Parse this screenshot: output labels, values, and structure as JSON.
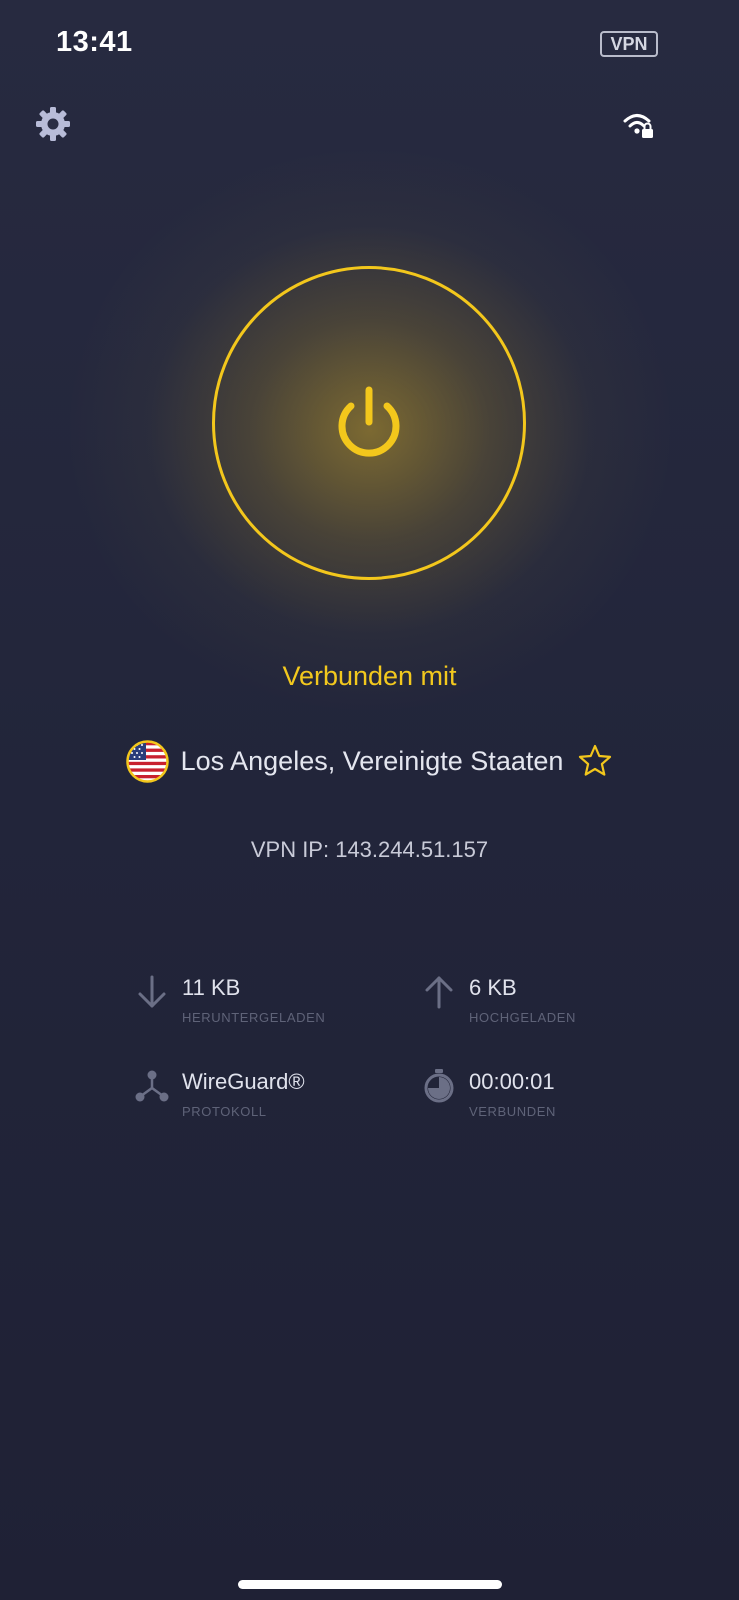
{
  "status_bar": {
    "time": "13:41",
    "vpn_badge": "VPN"
  },
  "header": {
    "settings_icon": "gear-icon",
    "network_icon": "wifi-lock-icon"
  },
  "connection": {
    "status": "Verbunden mit",
    "location": "Los Angeles, Vereinigte Staaten",
    "country_flag": "us-flag-icon",
    "favorite_icon": "star-icon",
    "vpn_ip": "VPN IP: 143.244.51.157"
  },
  "stats": {
    "download": {
      "value": "11 KB",
      "caption": "HERUNTERGELADEN"
    },
    "upload": {
      "value": "6 KB",
      "caption": "HOCHGELADEN"
    },
    "protocol": {
      "value": "WireGuard®",
      "caption": "PROTOKOLL"
    },
    "duration": {
      "value": "00:00:01",
      "caption": "VERBUNDEN"
    }
  },
  "colors": {
    "background": "#23263b",
    "accent": "#f3c71c",
    "text_primary": "#e4e6ef",
    "text_caption": "#5f6378"
  }
}
